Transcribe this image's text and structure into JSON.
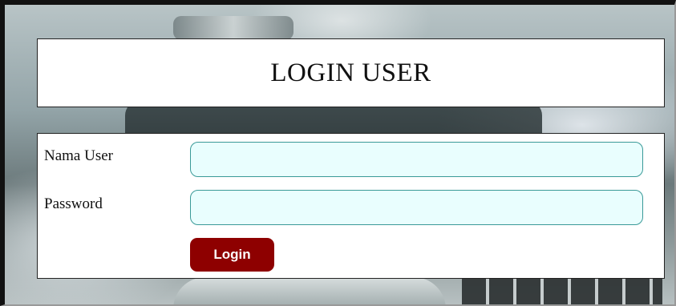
{
  "header": {
    "title": "LOGIN USER"
  },
  "form": {
    "username": {
      "label": "Nama User",
      "value": "",
      "placeholder": ""
    },
    "password": {
      "label": "Password",
      "value": "",
      "placeholder": ""
    },
    "submit_label": "Login"
  },
  "colors": {
    "input_background": "#e9fefe",
    "input_border": "#3a9a98",
    "button_background": "#8e0000",
    "button_text": "#ffffff"
  }
}
